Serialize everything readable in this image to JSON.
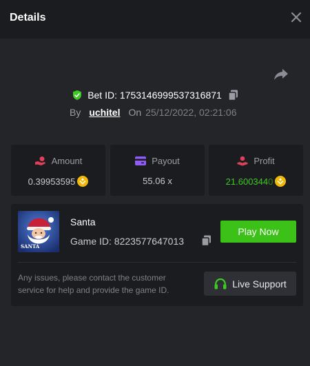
{
  "header": {
    "title": "Details"
  },
  "bet": {
    "id_label": "Bet ID: 1753146999537316871",
    "by_label": "By",
    "username": "uchitel",
    "on_label": "On",
    "datetime": "25/12/2022, 02:21:06"
  },
  "stats": [
    {
      "label": "Amount",
      "value": "0.39953595"
    },
    {
      "label": "Payout",
      "value": "55.06 x"
    },
    {
      "label": "Profit",
      "value_main": "21.600344",
      "value_trail": "0"
    }
  ],
  "game": {
    "thumb_text": "SANTA",
    "name": "Santa",
    "id_label": "Game ID: 8223577647013",
    "play_label": "Play Now",
    "issues_text": "Any issues, please contact the customer service for help and provide the game ID.",
    "support_label": "Live Support"
  },
  "colors": {
    "accent_green": "#3bc117",
    "profit_green": "#3dca24",
    "amount_icon": "#e0405a",
    "payout_icon": "#8f5cf6",
    "coin": "#f0b90b"
  },
  "icons": {
    "close": "close-icon",
    "share": "share-icon",
    "verified": "shield-check-icon",
    "copy": "copy-icon",
    "amount": "hand-coin-icon",
    "payout": "card-icon",
    "profit": "hand-user-icon",
    "currency": "bnb-coin-icon",
    "support": "headset-icon"
  }
}
